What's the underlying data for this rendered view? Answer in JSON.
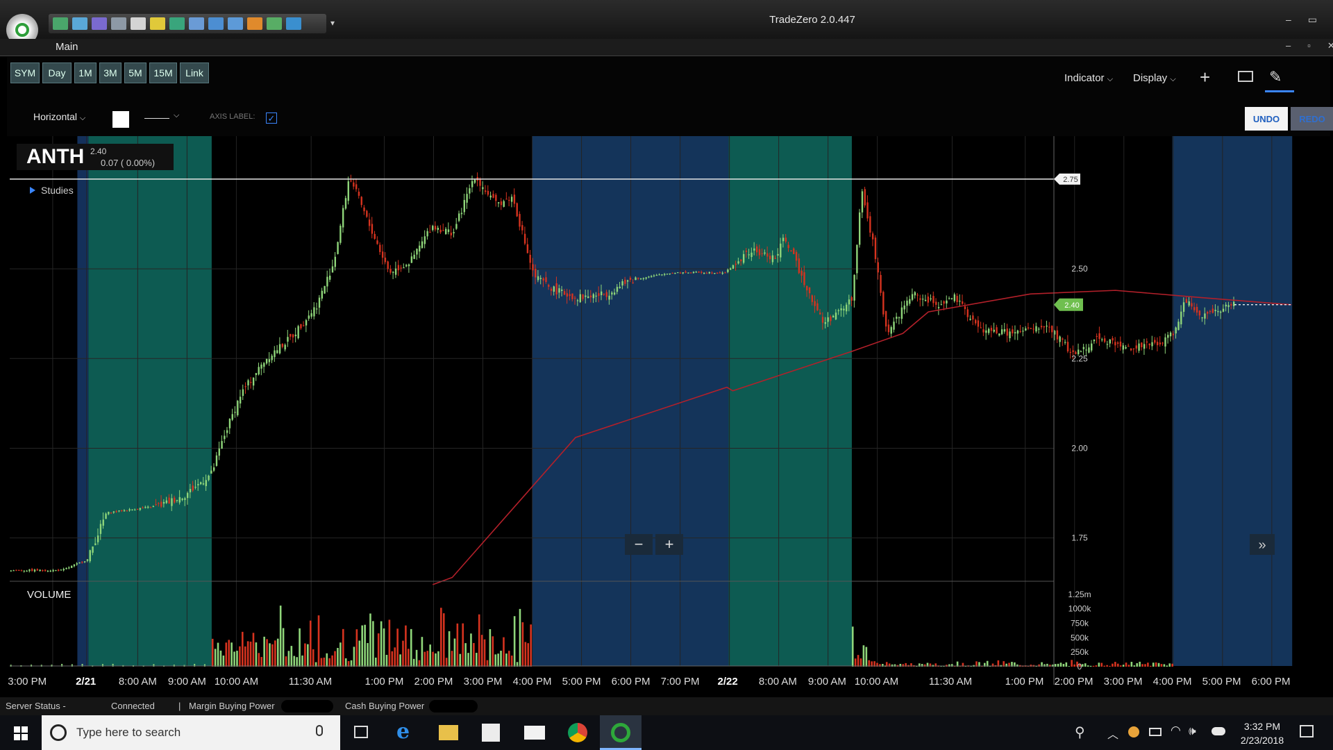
{
  "window": {
    "title": "TradeZero 2.0.447",
    "subtitle": "Main"
  },
  "toolbar": {
    "timeframes": [
      "SYM",
      "Day",
      "1M",
      "3M",
      "5M",
      "15M",
      "Link"
    ],
    "indicator_label": "Indicator",
    "display_label": "Display",
    "draw_type": "Horizontal",
    "axis_label_text": "AXIS LABEL:",
    "axis_label_checked": true,
    "undo_label": "UNDO",
    "redo_label": "REDO"
  },
  "symbol": {
    "ticker": "ANTH",
    "price": "2.40",
    "change": "0.07 ( 0.00%)",
    "studies_label": "Studies"
  },
  "chart_data": {
    "type": "candlestick",
    "price_ticks": [
      "2.50",
      "2.25",
      "2.00",
      "1.75"
    ],
    "horizontal_line_label": "2.75",
    "last_price_label": "2.40",
    "volume_label": "VOLUME",
    "volume_ticks": [
      "1.25m",
      "1000k",
      "750k",
      "500k",
      "250k",
      "0"
    ],
    "x_labels": [
      "3:00 PM",
      "2/21",
      "8:00 AM",
      "9:00 AM",
      "10:00 AM",
      "11:30 AM",
      "1:00 PM",
      "2:00 PM",
      "3:00 PM",
      "4:00 PM",
      "5:00 PM",
      "6:00 PM",
      "7:00 PM",
      "2/22",
      "8:00 AM",
      "9:00 AM",
      "10:00 AM",
      "11:30 AM",
      "1:00 PM",
      "2:00 PM",
      "3:00 PM",
      "4:00 PM",
      "5:00 PM",
      "6:00 PM"
    ],
    "bold_x_labels": [
      "2/21",
      "2/22"
    ],
    "y_range": [
      1.62,
      2.87
    ],
    "volume_range": [
      0,
      1400000
    ],
    "horizontal_line_value": 2.75,
    "series": [
      {
        "type": "close_price_path",
        "color": "#8aa88a",
        "points": [
          [
            0,
            1.66
          ],
          [
            60,
            1.66
          ],
          [
            90,
            1.69
          ],
          [
            112,
            1.82
          ],
          [
            175,
            1.84
          ],
          [
            205,
            1.87
          ],
          [
            236,
            1.93
          ],
          [
            250,
            2.03
          ],
          [
            270,
            2.15
          ],
          [
            300,
            2.25
          ],
          [
            330,
            2.31
          ],
          [
            360,
            2.4
          ],
          [
            380,
            2.52
          ],
          [
            398,
            2.76
          ],
          [
            420,
            2.63
          ],
          [
            445,
            2.49
          ],
          [
            470,
            2.52
          ],
          [
            495,
            2.62
          ],
          [
            520,
            2.6
          ],
          [
            545,
            2.76
          ],
          [
            570,
            2.68
          ],
          [
            590,
            2.7
          ],
          [
            615,
            2.48
          ],
          [
            640,
            2.44
          ],
          [
            665,
            2.42
          ],
          [
            700,
            2.43
          ],
          [
            730,
            2.47
          ],
          [
            780,
            2.49
          ],
          [
            840,
            2.49
          ],
          [
            870,
            2.55
          ],
          [
            900,
            2.53
          ],
          [
            910,
            2.59
          ],
          [
            930,
            2.48
          ],
          [
            955,
            2.35
          ],
          [
            975,
            2.38
          ],
          [
            990,
            2.42
          ],
          [
            1000,
            2.72
          ],
          [
            1015,
            2.56
          ],
          [
            1030,
            2.32
          ],
          [
            1060,
            2.43
          ],
          [
            1090,
            2.4
          ],
          [
            1110,
            2.42
          ],
          [
            1140,
            2.33
          ],
          [
            1180,
            2.32
          ],
          [
            1220,
            2.34
          ],
          [
            1250,
            2.26
          ],
          [
            1280,
            2.31
          ],
          [
            1310,
            2.28
          ],
          [
            1350,
            2.29
          ],
          [
            1370,
            2.33
          ],
          [
            1380,
            2.42
          ],
          [
            1400,
            2.37
          ],
          [
            1440,
            2.4
          ],
          [
            1507,
            2.4
          ]
        ]
      },
      {
        "type": "vwap",
        "color": "#b3202a",
        "points": [
          [
            497,
            1.62
          ],
          [
            520,
            1.64
          ],
          [
            665,
            2.03
          ],
          [
            843,
            2.17
          ],
          [
            850,
            2.16
          ],
          [
            990,
            2.27
          ],
          [
            1050,
            2.32
          ],
          [
            1080,
            2.38
          ],
          [
            1200,
            2.43
          ],
          [
            1300,
            2.44
          ],
          [
            1400,
            2.42
          ],
          [
            1507,
            2.4
          ]
        ]
      }
    ],
    "shaded_sessions": [
      {
        "from": 79,
        "to": 92,
        "color": "#14305a"
      },
      {
        "from": 92,
        "to": 237,
        "color": "#0d5b52"
      },
      {
        "from": 614,
        "to": 845,
        "color": "#14345a"
      },
      {
        "from": 845,
        "to": 990,
        "color": "#0d5b52"
      },
      {
        "from": 1367,
        "to": 1508,
        "color": "#14345a"
      }
    ],
    "volume_clusters": [
      {
        "from": 237,
        "to": 614,
        "peak": 1.15
      },
      {
        "from": 990,
        "to": 1030,
        "peak": 0.95
      },
      {
        "from": 1030,
        "to": 1367,
        "peak": 0.12
      }
    ]
  },
  "status": {
    "server_status_label": "Server Status -",
    "connected": "Connected",
    "margin_label": "Margin Buying Power",
    "cash_label": "Cash Buying Power"
  },
  "taskbar": {
    "search_placeholder": "Type here to search",
    "time": "3:32 PM",
    "date": "2/23/2018"
  },
  "colors": {
    "up": "#8fd67a",
    "down": "#d6331f",
    "vwap": "#b3202a",
    "accent": "#3a86ff"
  }
}
